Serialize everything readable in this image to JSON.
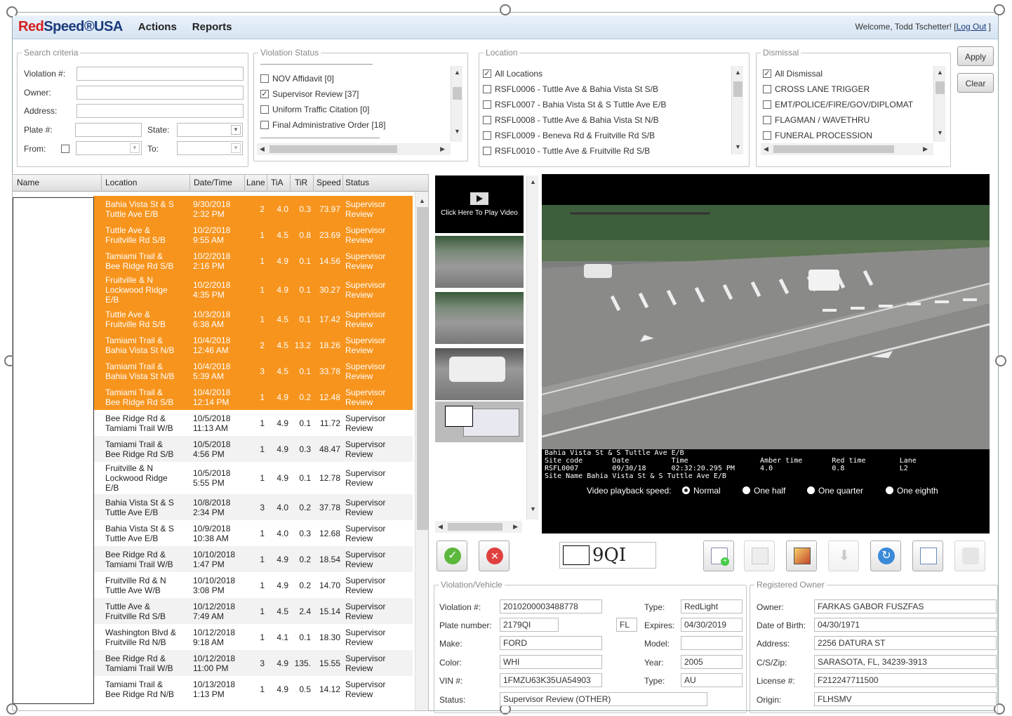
{
  "header": {
    "logo_red": "Red",
    "logo_rest": "Speed®USA",
    "menu": [
      "Actions",
      "Reports"
    ],
    "welcome": "Welcome, Todd Tschetter! [",
    "logout": "Log Out",
    "welcome_end": " ]"
  },
  "search": {
    "legend": "Search criteria",
    "violation_label": "Violation #:",
    "owner_label": "Owner:",
    "address_label": "Address:",
    "plate_label": "Plate #:",
    "state_label": "State:",
    "from_label": "From:",
    "to_label": "To:"
  },
  "violation_status": {
    "legend": "Violation Status",
    "items": [
      {
        "label": "NOV Affidavit [0]",
        "checked": false
      },
      {
        "label": "Supervisor Review [37]",
        "checked": true
      },
      {
        "label": "Uniform Traffic Citation [0]",
        "checked": false
      },
      {
        "label": "Final Administrative Order [18]",
        "checked": false
      }
    ]
  },
  "location": {
    "legend": "Location",
    "items": [
      {
        "label": "All Locations",
        "checked": true
      },
      {
        "label": "RSFL0006 - Tuttle Ave & Bahia Vista St S/B",
        "checked": false
      },
      {
        "label": "RSFL0007 - Bahia Vista St & S Tuttle Ave E/B",
        "checked": false
      },
      {
        "label": "RSFL0008 - Tuttle Ave & Bahia Vista St N/B",
        "checked": false
      },
      {
        "label": "RSFL0009 - Beneva Rd & Fruitville Rd S/B",
        "checked": false
      },
      {
        "label": "RSFL0010 - Tuttle Ave & Fruitville Rd S/B",
        "checked": false
      }
    ]
  },
  "dismissal": {
    "legend": "Dismissal",
    "items": [
      {
        "label": "All Dismissal",
        "checked": true
      },
      {
        "label": "CROSS LANE TRIGGER",
        "checked": false
      },
      {
        "label": "EMT/POLICE/FIRE/GOV/DIPLOMAT",
        "checked": false
      },
      {
        "label": "FLAGMAN / WAVETHRU",
        "checked": false
      },
      {
        "label": "FUNERAL PROCESSION",
        "checked": false
      }
    ]
  },
  "buttons": {
    "apply": "Apply",
    "clear": "Clear"
  },
  "grid": {
    "columns": [
      "Name",
      "Location",
      "Date/Time",
      "Lane",
      "TiA",
      "TiR",
      "Speed",
      "Status"
    ],
    "rows": [
      {
        "loc": [
          "Bahia Vista St & S",
          "Tuttle Ave E/B"
        ],
        "dt": [
          "9/30/2018",
          "2:32 PM"
        ],
        "lane": "2",
        "tia": "4.0",
        "tir": "0.3",
        "speed": "73.97",
        "status": [
          "Supervisor",
          "Review"
        ],
        "sel": true
      },
      {
        "loc": [
          "Tuttle Ave &",
          "Fruitville Rd S/B"
        ],
        "dt": [
          "10/2/2018",
          "9:55 AM"
        ],
        "lane": "1",
        "tia": "4.5",
        "tir": "0.8",
        "speed": "23.69",
        "status": [
          "Supervisor",
          "Review"
        ],
        "sel": true
      },
      {
        "loc": [
          "Tamiami Trail &",
          "Bee Ridge Rd S/B"
        ],
        "dt": [
          "10/2/2018",
          "2:16 PM"
        ],
        "lane": "1",
        "tia": "4.9",
        "tir": "0.1",
        "speed": "14.56",
        "status": [
          "Supervisor",
          "Review"
        ],
        "sel": true
      },
      {
        "loc": [
          "Fruitville & N",
          "Lockwood Ridge",
          "E/B"
        ],
        "dt": [
          "10/2/2018",
          "4:35 PM"
        ],
        "lane": "1",
        "tia": "4.9",
        "tir": "0.1",
        "speed": "30.27",
        "status": [
          "Supervisor",
          "Review"
        ],
        "sel": true
      },
      {
        "loc": [
          "Tuttle Ave &",
          "Fruitville Rd S/B"
        ],
        "dt": [
          "10/3/2018",
          "6:38 AM"
        ],
        "lane": "1",
        "tia": "4.5",
        "tir": "0.1",
        "speed": "17.42",
        "status": [
          "Supervisor",
          "Review"
        ],
        "sel": true
      },
      {
        "loc": [
          "Tamiami Trail &",
          "Bahia Vista St N/B"
        ],
        "dt": [
          "10/4/2018",
          "12:46 AM"
        ],
        "lane": "2",
        "tia": "4.5",
        "tir": "13.2",
        "speed": "18.26",
        "status": [
          "Supervisor",
          "Review"
        ],
        "sel": true
      },
      {
        "loc": [
          "Tamiami Trail &",
          "Bahia Vista St N/B"
        ],
        "dt": [
          "10/4/2018",
          "5:39 AM"
        ],
        "lane": "3",
        "tia": "4.5",
        "tir": "0.1",
        "speed": "33.78",
        "status": [
          "Supervisor",
          "Review"
        ],
        "sel": true
      },
      {
        "loc": [
          "Tamiami Trail &",
          "Bee Ridge Rd S/B"
        ],
        "dt": [
          "10/4/2018",
          "12:14 PM"
        ],
        "lane": "1",
        "tia": "4.9",
        "tir": "0.2",
        "speed": "12.48",
        "status": [
          "Supervisor",
          "Review"
        ],
        "sel": true
      },
      {
        "loc": [
          "Bee Ridge Rd &",
          "Tamiami Trail W/B"
        ],
        "dt": [
          "10/5/2018",
          "11:13 AM"
        ],
        "lane": "1",
        "tia": "4.9",
        "tir": "0.1",
        "speed": "11.72",
        "status": [
          "Supervisor",
          "Review"
        ],
        "sel": false
      },
      {
        "loc": [
          "Tamiami Trail &",
          "Bee Ridge Rd S/B"
        ],
        "dt": [
          "10/5/2018",
          "4:56 PM"
        ],
        "lane": "1",
        "tia": "4.9",
        "tir": "0.3",
        "speed": "48.47",
        "status": [
          "Supervisor",
          "Review"
        ],
        "sel": false
      },
      {
        "loc": [
          "Fruitville & N",
          "Lockwood Ridge",
          "E/B"
        ],
        "dt": [
          "10/5/2018",
          "5:55 PM"
        ],
        "lane": "1",
        "tia": "4.9",
        "tir": "0.1",
        "speed": "12.78",
        "status": [
          "Supervisor",
          "Review"
        ],
        "sel": false
      },
      {
        "loc": [
          "Bahia Vista St & S",
          "Tuttle Ave E/B"
        ],
        "dt": [
          "10/8/2018",
          "2:34 PM"
        ],
        "lane": "3",
        "tia": "4.0",
        "tir": "0.2",
        "speed": "37.78",
        "status": [
          "Supervisor",
          "Review"
        ],
        "sel": false
      },
      {
        "loc": [
          "Bahia Vista St & S",
          "Tuttle Ave E/B"
        ],
        "dt": [
          "10/9/2018",
          "10:38 AM"
        ],
        "lane": "1",
        "tia": "4.0",
        "tir": "0.3",
        "speed": "12.68",
        "status": [
          "Supervisor",
          "Review"
        ],
        "sel": false
      },
      {
        "loc": [
          "Bee Ridge Rd &",
          "Tamiami Trail W/B"
        ],
        "dt": [
          "10/10/2018",
          "1:47 PM"
        ],
        "lane": "1",
        "tia": "4.9",
        "tir": "0.2",
        "speed": "18.54",
        "status": [
          "Supervisor",
          "Review"
        ],
        "sel": false
      },
      {
        "loc": [
          "Fruitville Rd & N",
          "Tuttle Ave W/B"
        ],
        "dt": [
          "10/10/2018",
          "3:08 PM"
        ],
        "lane": "1",
        "tia": "4.9",
        "tir": "0.2",
        "speed": "14.70",
        "status": [
          "Supervisor",
          "Review"
        ],
        "sel": false
      },
      {
        "loc": [
          "Tuttle Ave &",
          "Fruitville Rd S/B"
        ],
        "dt": [
          "10/12/2018",
          "7:49 AM"
        ],
        "lane": "1",
        "tia": "4.5",
        "tir": "2.4",
        "speed": "15.14",
        "status": [
          "Supervisor",
          "Review"
        ],
        "sel": false
      },
      {
        "loc": [
          "Washington Blvd &",
          "Fruitville Rd N/B"
        ],
        "dt": [
          "10/12/2018",
          "9:18 AM"
        ],
        "lane": "1",
        "tia": "4.1",
        "tir": "0.1",
        "speed": "18.30",
        "status": [
          "Supervisor",
          "Review"
        ],
        "sel": false
      },
      {
        "loc": [
          "Bee Ridge Rd &",
          "Tamiami Trail W/B"
        ],
        "dt": [
          "10/12/2018",
          "11:00 PM"
        ],
        "lane": "3",
        "tia": "4.9",
        "tir": "135.",
        "speed": "15.55",
        "status": [
          "Supervisor",
          "Review"
        ],
        "sel": false
      },
      {
        "loc": [
          "Tamiami Trail &",
          "Bee Ridge Rd N/B"
        ],
        "dt": [
          "10/13/2018",
          "1:13 PM"
        ],
        "lane": "1",
        "tia": "4.9",
        "tir": "0.5",
        "speed": "14.12",
        "status": [
          "Supervisor",
          "Review"
        ],
        "sel": false
      }
    ]
  },
  "video": {
    "play_text": "Click Here To Play Video",
    "overlay_line1": "Bahia Vista St & S Tuttle Ave E/B",
    "overlay_line2": "Site code       Date          Time                 Amber time       Red time        Lane",
    "overlay_line3": "RSFL0007        09/30/18      02:32:20.295 PM      4.0              0.8             L2",
    "overlay_line4": "Site Name Bahia Vista St & S Tuttle Ave E/B",
    "speed_label": "Video playback speed:",
    "speeds": [
      "Normal",
      "One half",
      "One quarter",
      "One eighth"
    ],
    "selected_speed": "Normal"
  },
  "plate_text": "9QI",
  "violation_vehicle": {
    "legend": "Violation/Vehicle",
    "violation_label": "Violation #:",
    "violation": "2010200003488778",
    "type_label": "Type:",
    "type": "RedLight",
    "plate_label": "Plate number:",
    "plate": "2179QI",
    "state": "FL",
    "expires_label": "Expires:",
    "expires": "04/30/2019",
    "make_label": "Make:",
    "make": "FORD",
    "model_label": "Model:",
    "model": "",
    "color_label": "Color:",
    "color": "WHI",
    "year_label": "Year:",
    "year": "2005",
    "vin_label": "VIN #:",
    "vin": "1FMZU63K35UA54903",
    "type2_label": "Type:",
    "type2": "AU",
    "status_label": "Status:",
    "status": "Supervisor Review (OTHER)"
  },
  "owner": {
    "legend": "Registered Owner",
    "owner_label": "Owner:",
    "owner": "FARKAS GABOR FUSZFAS",
    "dob_label": "Date of Birth:",
    "dob": "04/30/1971",
    "address_label": "Address:",
    "address": "2256 DATURA ST",
    "csz_label": "C/S/Zip:",
    "csz": "SARASOTA, FL, 34239-3913",
    "license_label": "License #:",
    "license": "F212247711500",
    "origin_label": "Origin:",
    "origin": "FLHSMV"
  },
  "colors": {
    "selected_row": "#f7941d",
    "brand_red": "#d42020",
    "brand_blue": "#1a3a7a"
  }
}
